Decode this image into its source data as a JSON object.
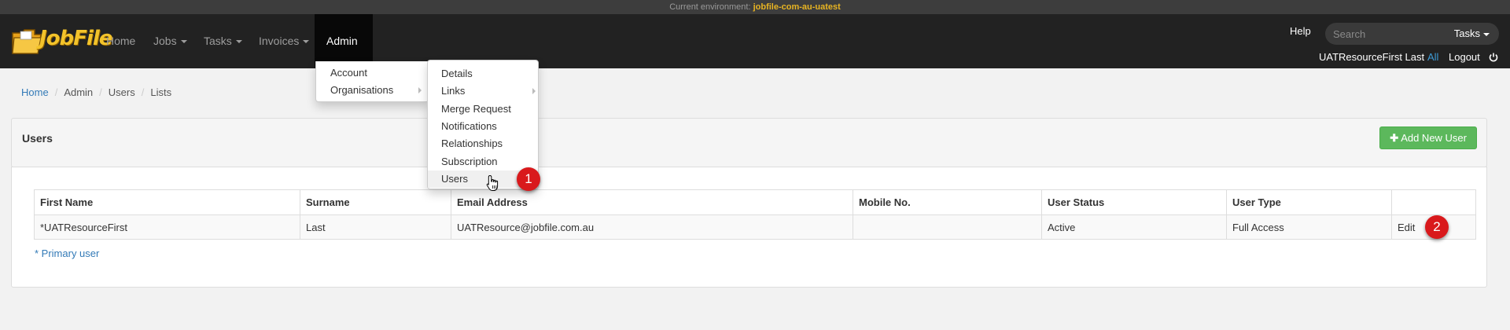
{
  "env_bar": {
    "label": "Current environment:",
    "name": "jobfile-com-au-uatest"
  },
  "brand": {
    "logo_text": "JobFile",
    "accent": "#f3c32b"
  },
  "nav": {
    "items": [
      {
        "label": "Home"
      },
      {
        "label": "Jobs"
      },
      {
        "label": "Tasks"
      },
      {
        "label": "Invoices"
      },
      {
        "label": "Admin",
        "active": true
      }
    ],
    "help": "Help",
    "search_placeholder": "Search",
    "search_scope": "Tasks",
    "user_name": "UATResourceFirst Last",
    "all_label": "All",
    "logout_label": "Logout"
  },
  "breadcrumb": [
    "Home",
    "Admin",
    "Users",
    "Lists"
  ],
  "admin_menu": {
    "items": [
      {
        "label": "Account"
      },
      {
        "label": "Organisations",
        "has_submenu": true
      }
    ]
  },
  "org_submenu": {
    "items": [
      {
        "label": "Details"
      },
      {
        "label": "Links",
        "has_submenu": true
      },
      {
        "label": "Merge Request"
      },
      {
        "label": "Notifications"
      },
      {
        "label": "Relationships"
      },
      {
        "label": "Subscription"
      },
      {
        "label": "Users",
        "hover": true
      }
    ]
  },
  "panel": {
    "title": "Users",
    "add_button": "Add New User",
    "add_button_color": "#5cb85c"
  },
  "table": {
    "columns": [
      "First Name",
      "Surname",
      "Email Address",
      "Mobile No.",
      "User Status",
      "User Type",
      ""
    ],
    "rows": [
      {
        "first_name": "*UATResourceFirst",
        "surname": "Last",
        "email": "UATResource@jobfile.com.au",
        "mobile": "",
        "status": "Active",
        "type": "Full Access",
        "action": "Edit"
      }
    ],
    "primary_note": "* Primary user"
  },
  "callouts": [
    "1",
    "2"
  ]
}
